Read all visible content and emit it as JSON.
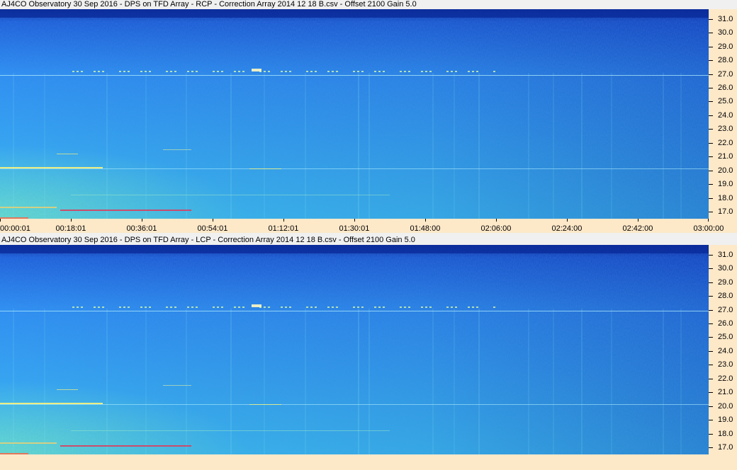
{
  "panels": [
    {
      "title": "AJ4CO Observatory 30 Sep 2016  -  DPS on TFD Array  -  RCP  -  Correction Array 2014 12 18 B.csv  -  Offset 2100  Gain 5.0",
      "polarization": "RCP"
    },
    {
      "title": "AJ4CO Observatory 30 Sep 2016  -  DPS on TFD Array  -  LCP  -  Correction Array 2014 12 18 B.csv  -  Offset 2100  Gain 5.0",
      "polarization": "LCP"
    }
  ],
  "chart_data": [
    {
      "type": "heatmap",
      "title": "AJ4CO Observatory 30 Sep 2016  -  DPS on TFD Array  -  RCP  -  Correction Array 2014 12 18 B.csv  -  Offset 2100  Gain 5.0",
      "x_ticks": [
        "00:00:01",
        "00:18:01",
        "00:36:01",
        "00:54:01",
        "01:12:01",
        "01:30:01",
        "01:48:00",
        "02:06:00",
        "02:24:00",
        "02:42:00",
        "03:00:00"
      ],
      "y_ticks": [
        "17.0",
        "18.0",
        "19.0",
        "20.0",
        "21.0",
        "22.0",
        "23.0",
        "24.0",
        "25.0",
        "26.0",
        "27.0",
        "28.0",
        "29.0",
        "30.0",
        "31.0"
      ],
      "y_range": [
        16.5,
        31.7
      ],
      "colormap": [
        "#0a2a9a",
        "#1a5ed8",
        "#2a8ef0",
        "#38c0f0",
        "#70e8c0",
        "#e8f060",
        "#ff6040"
      ]
    },
    {
      "type": "heatmap",
      "title": "AJ4CO Observatory 30 Sep 2016  -  DPS on TFD Array  -  LCP  -  Correction Array 2014 12 18 B.csv  -  Offset 2100  Gain 5.0",
      "x_ticks": [],
      "y_ticks": [
        "17.0",
        "18.0",
        "19.0",
        "20.0",
        "21.0",
        "22.0",
        "23.0",
        "24.0",
        "25.0",
        "26.0",
        "27.0",
        "28.0",
        "29.0",
        "30.0",
        "31.0"
      ],
      "y_range": [
        16.5,
        31.7
      ],
      "colormap": [
        "#0a2a9a",
        "#1a5ed8",
        "#2a8ef0",
        "#38c0f0",
        "#70e8c0",
        "#e8f060",
        "#ff6040"
      ]
    }
  ]
}
